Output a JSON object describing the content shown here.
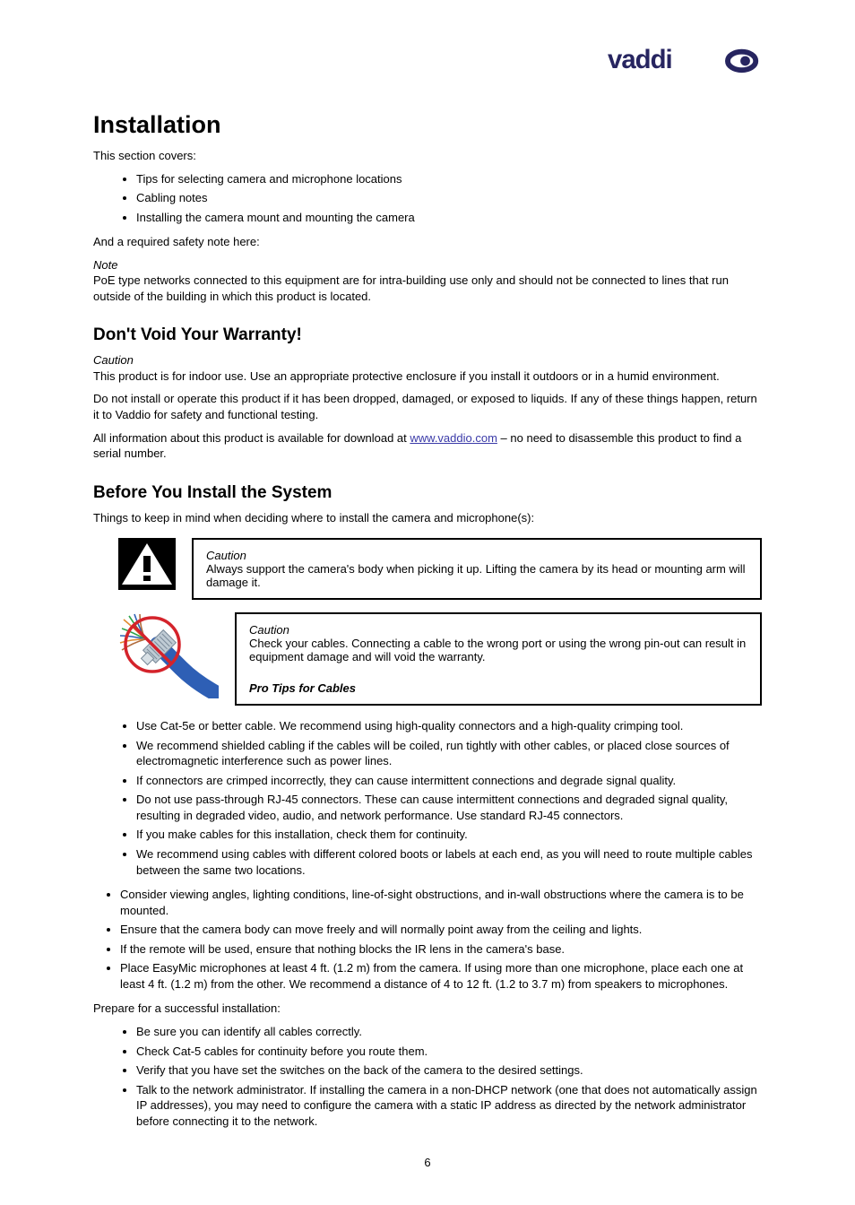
{
  "logo": {
    "name": "vaddio-logo"
  },
  "h_installation": "Installation",
  "p_intro1": "This section covers:",
  "intro_bullets": [
    "Tips for selecting camera and microphone locations",
    "Cabling notes",
    "Installing the camera mount and mounting the camera"
  ],
  "p_intro2_prefix": "And a required safety note here:",
  "note_label": "Note",
  "note_text": "PoE type networks connected to this equipment are for intra-building use only and should not be connected to lines that run outside of the building in which this product is located.",
  "h_dont_void": "Don't Void Your Warranty!",
  "caution1_label": "Caution",
  "caution1_text": "This product is for indoor use. Use an appropriate protective enclosure if you install it outdoors or in a humid environment.",
  "p_dont_void_1_prefix": "Do not install or operate this product if it has been dropped, damaged, or exposed to liquids. If any of these things happen, return it to Vaddio for safety and functional testing.",
  "p_dont_void_2": "All information about this product is available for download at ",
  "link_text": "www.vaddio.com",
  "p_dont_void_2_suffix": " – no need to disassemble this product to find a serial number.",
  "h_before_install": "Before You Install the System",
  "p_before_1": "Things to keep in mind when deciding where to install the camera and microphone(s):",
  "caution2_label": "Caution",
  "caution2_text": "Always support the camera's body when picking it up. Lifting the camera by its head or mounting arm will damage it.",
  "caution3_label": "Caution",
  "caution3_text": "Check your cables. Connecting a cable to the wrong port or using the wrong pin-out can result in equipment damage and will void the warranty.",
  "pro_tips_label": "Pro Tips for Cables",
  "pro_tips_bullets": [
    "Use Cat-5e or better cable. We recommend using high-quality connectors and a high-quality crimping tool.",
    "We recommend shielded cabling if the cables will be coiled, run tightly with other cables, or placed close sources of electromagnetic interference such as power lines.",
    "If connectors are crimped incorrectly, they can cause intermittent connections and degrade signal quality.",
    "Do not use pass-through RJ-45 connectors. These can cause intermittent connections and degraded signal quality, resulting in degraded video, audio, and network performance. Use standard RJ-45 connectors.",
    "If you make cables for this installation, check them for continuity.",
    "We recommend using cables with different colored boots or labels at each end, as you will need to route multiple cables between the same two locations."
  ],
  "loc_bullets": [
    "Consider viewing angles, lighting conditions, line-of-sight obstructions, and in-wall obstructions where the camera is to be mounted.",
    "Ensure that the camera body can move freely and will normally point away from the ceiling and lights.",
    "If the remote will be used, ensure that nothing blocks the IR lens in the camera's base.",
    "Place EasyMic microphones at least 4 ft. (1.2 m) from the camera. If using more than one microphone, place each one at least 4 ft. (1.2 m) from the other. We recommend a distance of 4 to 12 ft. (1.2 to 3.7 m) from speakers to microphones."
  ],
  "p_prepare": "Prepare for a successful installation:",
  "prepare_bullets": [
    "Be sure you can identify all cables correctly.",
    "Check Cat-5 cables for continuity before you route them.",
    "Verify that you have set the switches on the back of the camera to the desired settings.",
    "Talk to the network administrator. If installing the camera in a non-DHCP network (one that does not automatically assign IP addresses), you may need to configure the camera with a static IP address as directed by the network administrator before connecting it to the network."
  ],
  "page_number": "6"
}
